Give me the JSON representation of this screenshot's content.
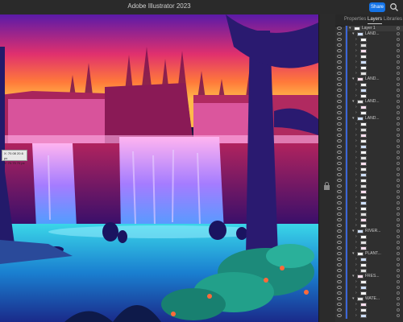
{
  "app": {
    "title": "Adobe Illustrator 2023",
    "share_label": "Share",
    "search_icon": "search-icon"
  },
  "measure": {
    "line1": "X: 70.08 20.6 px",
    "line2": "Y: 70.75 70 px"
  },
  "panel": {
    "tabs": [
      {
        "label": "Properties",
        "active": false
      },
      {
        "label": "Layers",
        "active": true
      },
      {
        "label": "Libraries",
        "active": false
      }
    ],
    "rows": [
      {
        "name": "Layer 1",
        "indent": 0,
        "expanded": true,
        "kind": "layer",
        "hl": true
      },
      {
        "name": "LAND...",
        "indent": 1,
        "expanded": true,
        "kind": "group",
        "hl": false
      },
      {
        "name": "",
        "indent": 2,
        "expanded": false,
        "kind": "item",
        "hl": false
      },
      {
        "name": "",
        "indent": 2,
        "expanded": false,
        "kind": "item",
        "hl": false
      },
      {
        "name": "",
        "indent": 2,
        "expanded": false,
        "kind": "item",
        "hl": false
      },
      {
        "name": "",
        "indent": 2,
        "expanded": false,
        "kind": "item",
        "hl": false
      },
      {
        "name": "",
        "indent": 2,
        "expanded": false,
        "kind": "item",
        "hl": false
      },
      {
        "name": "",
        "indent": 2,
        "expanded": false,
        "kind": "item",
        "hl": false
      },
      {
        "name": "",
        "indent": 2,
        "expanded": false,
        "kind": "item",
        "hl": false
      },
      {
        "name": "LAND...",
        "indent": 1,
        "expanded": true,
        "kind": "group",
        "hl": false
      },
      {
        "name": "",
        "indent": 2,
        "expanded": false,
        "kind": "item",
        "hl": false
      },
      {
        "name": "",
        "indent": 2,
        "expanded": false,
        "kind": "item",
        "hl": false
      },
      {
        "name": "",
        "indent": 2,
        "expanded": false,
        "kind": "item",
        "hl": false
      },
      {
        "name": "LAND...",
        "indent": 1,
        "expanded": true,
        "kind": "group",
        "hl": false
      },
      {
        "name": "",
        "indent": 2,
        "expanded": false,
        "kind": "item",
        "hl": false
      },
      {
        "name": "",
        "indent": 2,
        "expanded": false,
        "kind": "item",
        "hl": false
      },
      {
        "name": "LAND...",
        "indent": 1,
        "expanded": true,
        "kind": "group",
        "hl": false
      },
      {
        "name": "",
        "indent": 2,
        "expanded": false,
        "kind": "item",
        "hl": false
      },
      {
        "name": "",
        "indent": 2,
        "expanded": false,
        "kind": "item",
        "hl": false
      },
      {
        "name": "",
        "indent": 2,
        "expanded": false,
        "kind": "item",
        "hl": false
      },
      {
        "name": "",
        "indent": 2,
        "expanded": false,
        "kind": "item",
        "hl": false
      },
      {
        "name": "",
        "indent": 2,
        "expanded": false,
        "kind": "item",
        "hl": false
      },
      {
        "name": "",
        "indent": 2,
        "expanded": false,
        "kind": "item",
        "hl": false
      },
      {
        "name": "",
        "indent": 2,
        "expanded": false,
        "kind": "item",
        "hl": false
      },
      {
        "name": "",
        "indent": 2,
        "expanded": false,
        "kind": "item",
        "hl": false
      },
      {
        "name": "",
        "indent": 2,
        "expanded": false,
        "kind": "item",
        "hl": false
      },
      {
        "name": "",
        "indent": 2,
        "expanded": false,
        "kind": "item",
        "hl": false
      },
      {
        "name": "",
        "indent": 2,
        "expanded": false,
        "kind": "item",
        "hl": false
      },
      {
        "name": "",
        "indent": 2,
        "expanded": false,
        "kind": "item",
        "hl": false
      },
      {
        "name": "",
        "indent": 2,
        "expanded": false,
        "kind": "item",
        "hl": false
      },
      {
        "name": "",
        "indent": 2,
        "expanded": false,
        "kind": "item",
        "hl": false
      },
      {
        "name": "",
        "indent": 2,
        "expanded": false,
        "kind": "item",
        "hl": false
      },
      {
        "name": "",
        "indent": 2,
        "expanded": false,
        "kind": "item",
        "hl": false
      },
      {
        "name": "",
        "indent": 2,
        "expanded": false,
        "kind": "item",
        "hl": false
      },
      {
        "name": "",
        "indent": 2,
        "expanded": false,
        "kind": "item",
        "hl": false
      },
      {
        "name": "",
        "indent": 2,
        "expanded": false,
        "kind": "item",
        "hl": false
      },
      {
        "name": "RIVER...",
        "indent": 1,
        "expanded": true,
        "kind": "group",
        "hl": false
      },
      {
        "name": "",
        "indent": 2,
        "expanded": false,
        "kind": "item",
        "hl": false
      },
      {
        "name": "",
        "indent": 2,
        "expanded": false,
        "kind": "item",
        "hl": false
      },
      {
        "name": "",
        "indent": 2,
        "expanded": false,
        "kind": "item",
        "hl": false
      },
      {
        "name": "PLANT...",
        "indent": 1,
        "expanded": true,
        "kind": "group",
        "hl": false
      },
      {
        "name": "",
        "indent": 2,
        "expanded": false,
        "kind": "item",
        "hl": false
      },
      {
        "name": "",
        "indent": 2,
        "expanded": false,
        "kind": "item",
        "hl": false
      },
      {
        "name": "",
        "indent": 2,
        "expanded": false,
        "kind": "item",
        "hl": false
      },
      {
        "name": "FRES...",
        "indent": 1,
        "expanded": true,
        "kind": "group",
        "hl": false
      },
      {
        "name": "",
        "indent": 2,
        "expanded": false,
        "kind": "item",
        "hl": false
      },
      {
        "name": "",
        "indent": 2,
        "expanded": false,
        "kind": "item",
        "hl": false
      },
      {
        "name": "",
        "indent": 2,
        "expanded": false,
        "kind": "item",
        "hl": false
      },
      {
        "name": "WATE...",
        "indent": 1,
        "expanded": true,
        "kind": "group",
        "hl": false
      },
      {
        "name": "",
        "indent": 2,
        "expanded": false,
        "kind": "item",
        "hl": false
      },
      {
        "name": "",
        "indent": 2,
        "expanded": false,
        "kind": "item",
        "hl": false
      },
      {
        "name": "",
        "indent": 2,
        "expanded": false,
        "kind": "item",
        "hl": false
      }
    ]
  },
  "colors": {
    "accent": "#1473e6",
    "sky_top": "#6a1fb0",
    "sky_mid": "#ff3a7a",
    "sky_horizon": "#ffb03a",
    "water": "#1aa0d8",
    "falls": "#b98cff"
  }
}
